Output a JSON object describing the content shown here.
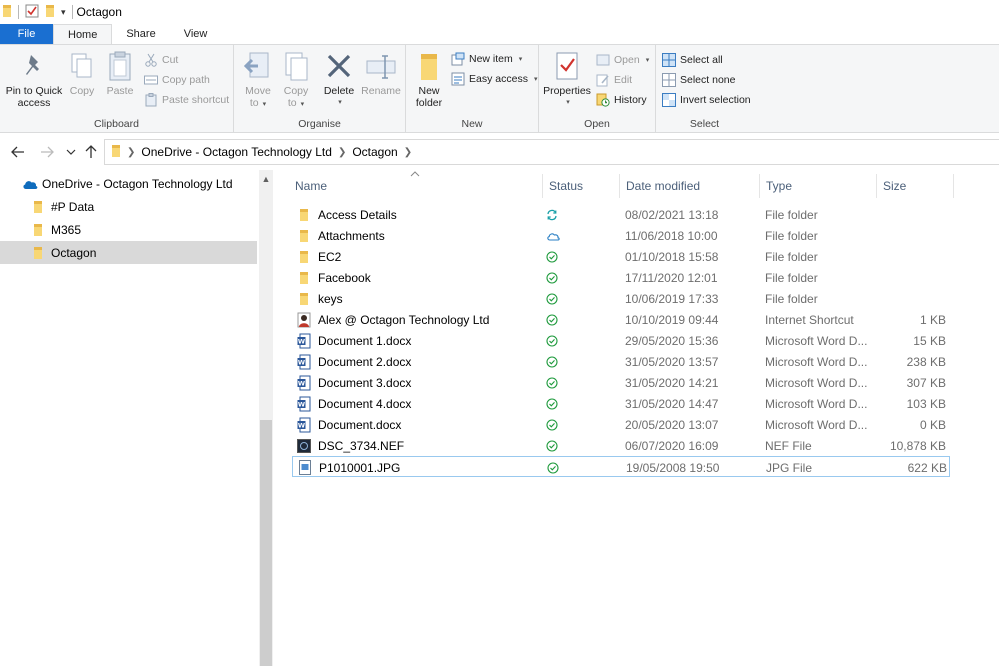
{
  "window": {
    "title": "Octagon"
  },
  "ribbon_tabs": [
    {
      "label": "File"
    },
    {
      "label": "Home"
    },
    {
      "label": "Share"
    },
    {
      "label": "View"
    }
  ],
  "clipboard": {
    "label": "Clipboard",
    "pin": "Pin to Quick access",
    "pin_line1": "Pin to Quick",
    "pin_line2": "access",
    "copy": "Copy",
    "paste": "Paste",
    "cut": "Cut",
    "copy_path": "Copy path",
    "paste_shortcut": "Paste shortcut"
  },
  "organise": {
    "label": "Organise",
    "move_to_line1": "Move",
    "move_to_line2": "to",
    "copy_to_line1": "Copy",
    "copy_to_line2": "to",
    "delete": "Delete",
    "rename": "Rename"
  },
  "new_group": {
    "label": "New",
    "new_folder_line1": "New",
    "new_folder_line2": "folder",
    "new_item": "New item",
    "easy_access": "Easy access"
  },
  "open_group": {
    "label": "Open",
    "properties": "Properties",
    "open": "Open",
    "edit": "Edit",
    "history": "History"
  },
  "select_group": {
    "label": "Select",
    "select_all": "Select all",
    "select_none": "Select none",
    "invert_selection": "Invert selection"
  },
  "breadcrumb": [
    "OneDrive - Octagon Technology Ltd",
    "Octagon"
  ],
  "nav_tree": [
    {
      "label": "OneDrive - Octagon Technology Ltd",
      "icon": "onedrive-cloud-icon"
    },
    {
      "label": "#P Data",
      "icon": "folder-icon"
    },
    {
      "label": "M365",
      "icon": "folder-icon"
    },
    {
      "label": "Octagon",
      "icon": "folder-icon",
      "selected": true
    }
  ],
  "columns": [
    "Name",
    "Status",
    "Date modified",
    "Type",
    "Size"
  ],
  "files": [
    {
      "name": "Access Details",
      "icon": "folder-icon",
      "status": "syncing",
      "date": "08/02/2021 13:18",
      "type": "File folder",
      "size": ""
    },
    {
      "name": "Attachments",
      "icon": "folder-icon",
      "status": "cloud",
      "date": "11/06/2018 10:00",
      "type": "File folder",
      "size": ""
    },
    {
      "name": "EC2",
      "icon": "folder-icon",
      "status": "available",
      "date": "01/10/2018 15:58",
      "type": "File folder",
      "size": ""
    },
    {
      "name": "Facebook",
      "icon": "folder-icon",
      "status": "available",
      "date": "17/11/2020 12:01",
      "type": "File folder",
      "size": ""
    },
    {
      "name": "keys",
      "icon": "folder-icon",
      "status": "available",
      "date": "10/06/2019 17:33",
      "type": "File folder",
      "size": ""
    },
    {
      "name": "Alex @ Octagon Technology Ltd",
      "icon": "internet-shortcut-icon",
      "status": "available",
      "date": "10/10/2019 09:44",
      "type": "Internet Shortcut",
      "size": "1 KB"
    },
    {
      "name": "Document 1.docx",
      "icon": "word-doc-icon",
      "status": "available",
      "date": "29/05/2020 15:36",
      "type": "Microsoft Word D...",
      "size": "15 KB"
    },
    {
      "name": "Document 2.docx",
      "icon": "word-doc-icon",
      "status": "available",
      "date": "31/05/2020 13:57",
      "type": "Microsoft Word D...",
      "size": "238 KB"
    },
    {
      "name": "Document 3.docx",
      "icon": "word-doc-icon",
      "status": "available",
      "date": "31/05/2020 14:21",
      "type": "Microsoft Word D...",
      "size": "307 KB"
    },
    {
      "name": "Document 4.docx",
      "icon": "word-doc-icon",
      "status": "available",
      "date": "31/05/2020 14:47",
      "type": "Microsoft Word D...",
      "size": "103 KB"
    },
    {
      "name": "Document.docx",
      "icon": "word-doc-icon",
      "status": "available",
      "date": "20/05/2020 13:07",
      "type": "Microsoft Word D...",
      "size": "0 KB"
    },
    {
      "name": "DSC_3734.NEF",
      "icon": "nef-image-icon",
      "status": "available",
      "date": "06/07/2020 16:09",
      "type": "NEF File",
      "size": "10,878 KB"
    },
    {
      "name": "P1010001.JPG",
      "icon": "jpg-image-icon",
      "status": "available",
      "date": "19/05/2008 19:50",
      "type": "JPG File",
      "size": "622 KB",
      "focused": true
    }
  ],
  "colors": {
    "file_tab": "#1a6fd1",
    "status_sync": "#1aa0a8",
    "status_ok": "#1e9a3c",
    "status_cloud": "#2a7fc4",
    "folder": "#f8d775"
  }
}
